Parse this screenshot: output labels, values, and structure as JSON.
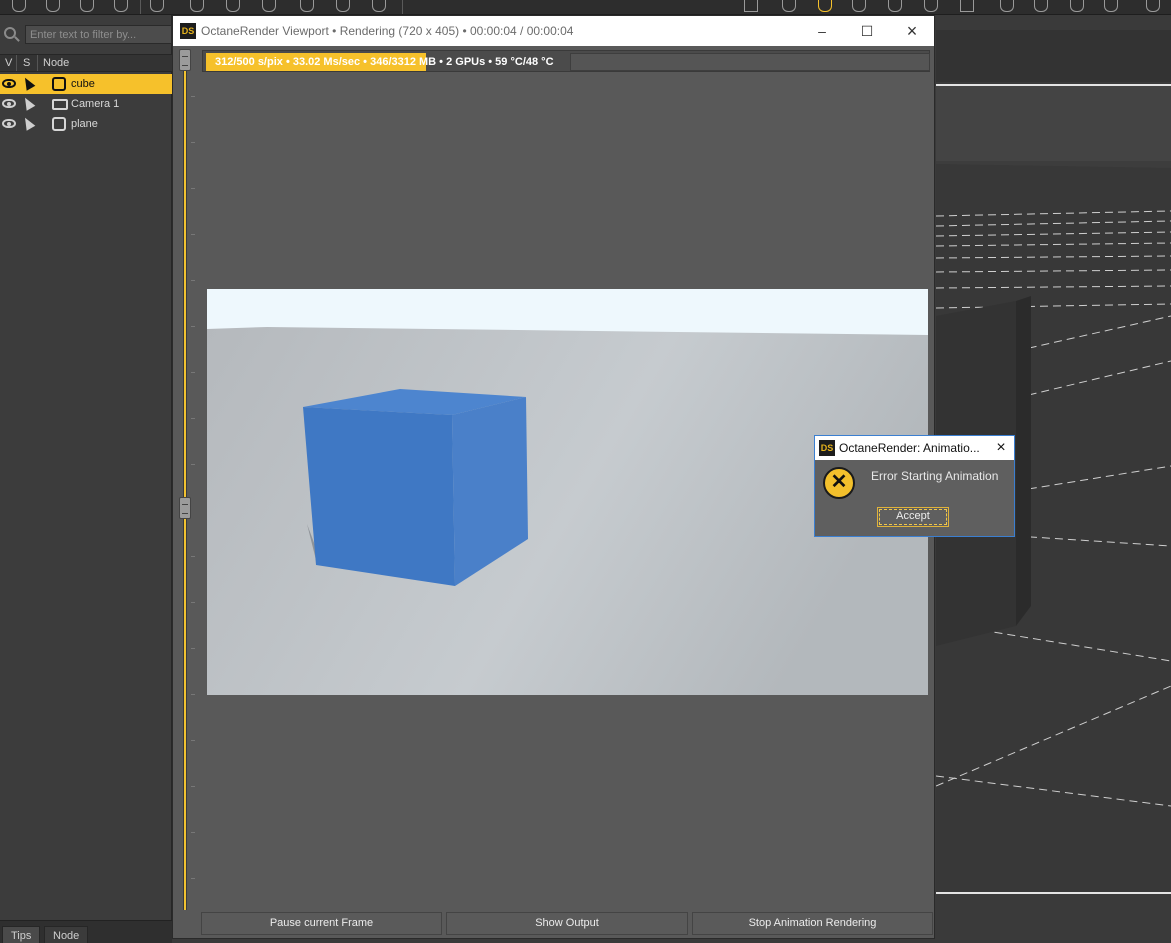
{
  "octane_window": {
    "title": "OctaneRender Viewport • Rendering (720 x 405) • 00:00:04 / 00:00:04",
    "status_text": "312/500 s/pix • 33.02 Ms/sec • 346/3312 MB • 2 GPUs • 59 °C/48 °C",
    "progress_fraction": 0.624,
    "buttons": {
      "pause": "Pause current Frame",
      "show_output": "Show Output",
      "stop": "Stop Animation Rendering"
    }
  },
  "scene_panel": {
    "filter_placeholder": "Enter text to filter by...",
    "columns": {
      "v": "V",
      "s": "S",
      "node": "Node"
    },
    "nodes": [
      {
        "label": "cube",
        "icon": "cube-icon",
        "selected": true
      },
      {
        "label": "Camera 1",
        "icon": "camera-icon",
        "selected": false
      },
      {
        "label": "plane",
        "icon": "plane-icon",
        "selected": false
      }
    ],
    "tabs": [
      "Tips",
      "Node"
    ]
  },
  "dialog": {
    "title": "OctaneRender: Animatio...",
    "message": "Error Starting Animation",
    "accept_label": "Accept",
    "icon": "error-icon"
  },
  "colors": {
    "accent": "#f6c12b",
    "cube": "#3f78c4",
    "dialog_border": "#3b7fd1"
  }
}
